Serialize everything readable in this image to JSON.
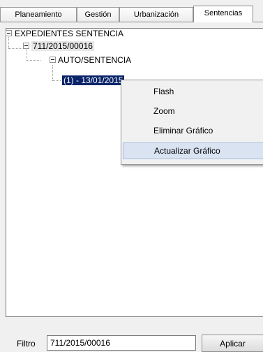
{
  "tabs": [
    {
      "label": "Planeamiento",
      "active": false
    },
    {
      "label": "Gestión",
      "active": false
    },
    {
      "label": "Urbanización",
      "active": false
    },
    {
      "label": "Sentencias",
      "active": true
    }
  ],
  "tree": {
    "root": {
      "label": "EXPEDIENTES SENTENCIA",
      "expanded": true
    },
    "expediente": {
      "label": "711/2015/00016",
      "expanded": true
    },
    "folder": {
      "label": "AUTO/SENTENCIA",
      "expanded": true
    },
    "selected_item": {
      "label": "(1) - 13/01/2015"
    }
  },
  "context_menu": {
    "items": [
      {
        "label": "Flash"
      },
      {
        "label": "Zoom"
      },
      {
        "label": "Eliminar Gráfico"
      },
      {
        "label": "Actualizar Gráfico",
        "highlighted": true
      }
    ]
  },
  "filter": {
    "label": "Filtro",
    "value": "711/2015/00016",
    "apply_label": "Aplicar"
  },
  "colors": {
    "selection": "#0a246a",
    "menu_hover": "#d9e3f2"
  }
}
